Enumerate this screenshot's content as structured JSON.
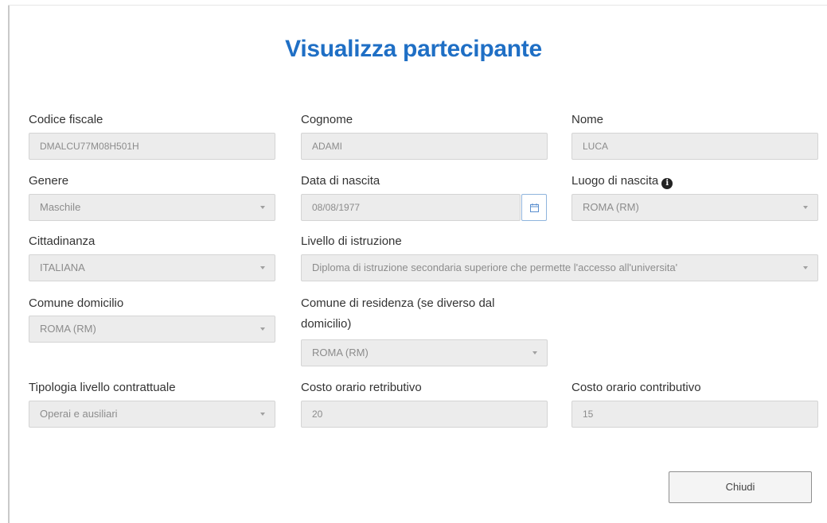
{
  "dialog": {
    "title": "Visualizza partecipante",
    "close_label": "Chiudi"
  },
  "fields": {
    "codice_fiscale": {
      "label": "Codice fiscale",
      "value": "DMALCU77M08H501H"
    },
    "cognome": {
      "label": "Cognome",
      "value": "ADAMI"
    },
    "nome": {
      "label": "Nome",
      "value": "LUCA"
    },
    "genere": {
      "label": "Genere",
      "value": "Maschile"
    },
    "data_nascita": {
      "label": "Data di nascita",
      "value": "08/08/1977"
    },
    "luogo_nascita": {
      "label": "Luogo di nascita",
      "value": "ROMA (RM)"
    },
    "cittadinanza": {
      "label": "Cittadinanza",
      "value": "ITALIANA"
    },
    "livello_istruzione": {
      "label": "Livello di istruzione",
      "value": "Diploma di istruzione secondaria superiore che permette l'accesso all'universita'"
    },
    "comune_domicilio": {
      "label": "Comune domicilio",
      "value": "ROMA (RM)"
    },
    "comune_residenza": {
      "label": "Comune di residenza (se diverso dal domicilio)",
      "value": "ROMA (RM)"
    },
    "tipologia_livello": {
      "label": "Tipologia livello contrattuale",
      "value": "Operai e ausiliari"
    },
    "costo_retributivo": {
      "label": "Costo orario retributivo",
      "value": "20"
    },
    "costo_contributivo": {
      "label": "Costo orario contributivo",
      "value": "15"
    }
  },
  "icons": {
    "info": "info-circle-icon",
    "calendar": "calendar-icon",
    "dropdown": "chevron-down-icon"
  },
  "colors": {
    "title": "#1f6fc5",
    "field_bg": "#ececec",
    "calendar_border": "#8fb4dd"
  }
}
